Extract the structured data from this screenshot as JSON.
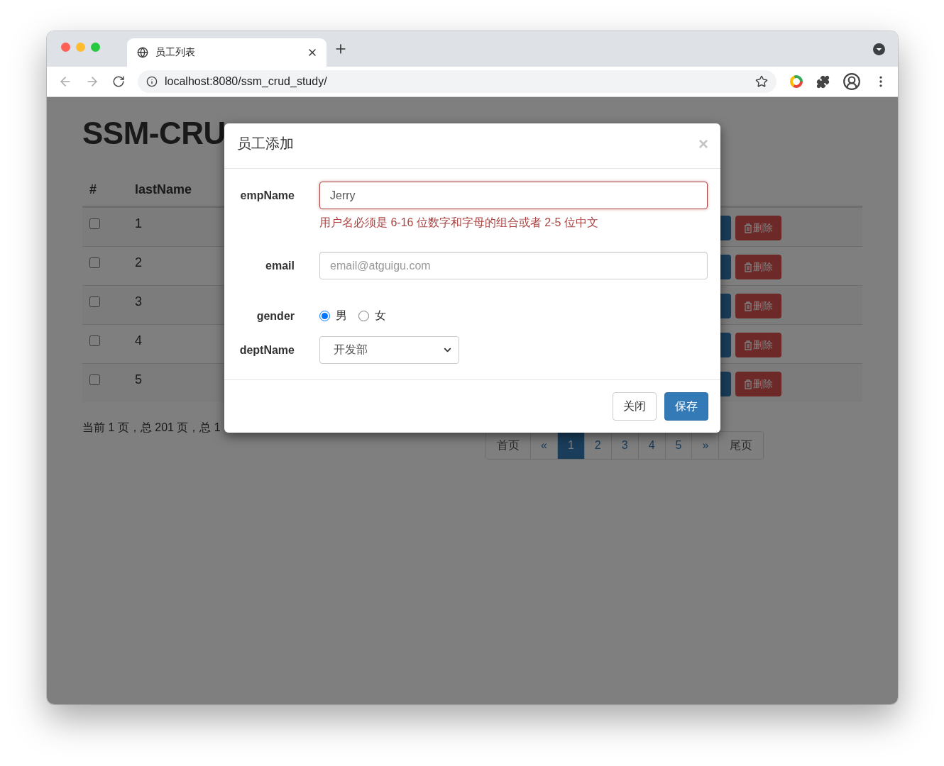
{
  "browser": {
    "tab": {
      "title": "员工列表"
    },
    "url": "localhost:8080/ssm_crud_study/"
  },
  "page": {
    "title": "SSM-CRU",
    "table": {
      "columns": [
        "#",
        "lastName"
      ],
      "rows": [
        {
          "checked": false,
          "cell": "1",
          "delete": "删除"
        },
        {
          "checked": false,
          "cell": "2",
          "delete": "删除"
        },
        {
          "checked": false,
          "cell": "3",
          "delete": "删除"
        },
        {
          "checked": false,
          "cell": "4",
          "delete": "删除"
        },
        {
          "checked": false,
          "cell": "5",
          "delete": "删除"
        }
      ]
    },
    "summary": "当前 1 页，总 201 页，总 1",
    "pagination": [
      {
        "label": "首页",
        "selected": false
      },
      {
        "label": "«",
        "selected": false
      },
      {
        "label": "1",
        "selected": true
      },
      {
        "label": "2",
        "selected": false
      },
      {
        "label": "3",
        "selected": false
      },
      {
        "label": "4",
        "selected": false
      },
      {
        "label": "5",
        "selected": false
      },
      {
        "label": "»",
        "selected": false
      },
      {
        "label": "尾页",
        "selected": false
      }
    ]
  },
  "modal": {
    "title": "员工添加",
    "close": "×",
    "fields": [
      {
        "kind": "text",
        "label": "empName",
        "value": "Jerry",
        "invalid": true,
        "error": "用户名必须是 6-16 位数字和字母的组合或者 2-5 位中文"
      },
      {
        "kind": "text",
        "label": "email",
        "placeholder": "email@atguigu.com",
        "invalid": false
      },
      {
        "kind": "radio",
        "label": "gender",
        "options": [
          {
            "label": "男",
            "selected": true
          },
          {
            "label": "女",
            "selected": false
          }
        ]
      },
      {
        "kind": "select",
        "label": "deptName",
        "value": "开发部"
      }
    ],
    "buttons": [
      {
        "label": "关闭",
        "kind": "default"
      },
      {
        "label": "保存",
        "kind": "primary"
      }
    ]
  }
}
